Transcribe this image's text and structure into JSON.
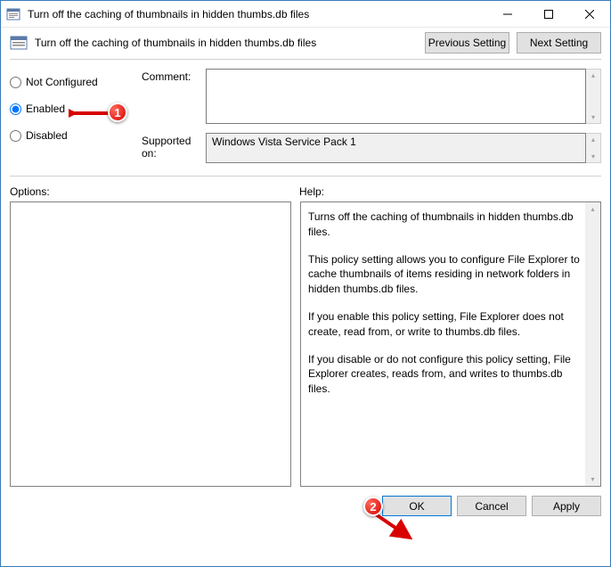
{
  "window": {
    "title": "Turn off the caching of thumbnails in hidden thumbs.db files"
  },
  "header": {
    "title": "Turn off the caching of thumbnails in hidden thumbs.db files",
    "prev_btn": "Previous Setting",
    "next_btn": "Next Setting"
  },
  "radios": {
    "not_configured": "Not Configured",
    "enabled": "Enabled",
    "disabled": "Disabled",
    "selected": "enabled"
  },
  "fields": {
    "comment_label": "Comment:",
    "comment_value": "",
    "supported_label": "Supported on:",
    "supported_value": "Windows Vista Service Pack 1"
  },
  "sections": {
    "options_label": "Options:",
    "help_label": "Help:"
  },
  "help": {
    "p1": "Turns off the caching of thumbnails in hidden thumbs.db files.",
    "p2": "This policy setting allows you to configure File Explorer to cache thumbnails of items residing in network folders in hidden thumbs.db files.",
    "p3": "If you enable this policy setting, File Explorer does not create, read from, or write to thumbs.db files.",
    "p4": "If you disable or do not configure this policy setting, File Explorer creates, reads from, and writes to thumbs.db files."
  },
  "footer": {
    "ok": "OK",
    "cancel": "Cancel",
    "apply": "Apply"
  },
  "annotations": {
    "badge1": "1",
    "badge2": "2"
  }
}
